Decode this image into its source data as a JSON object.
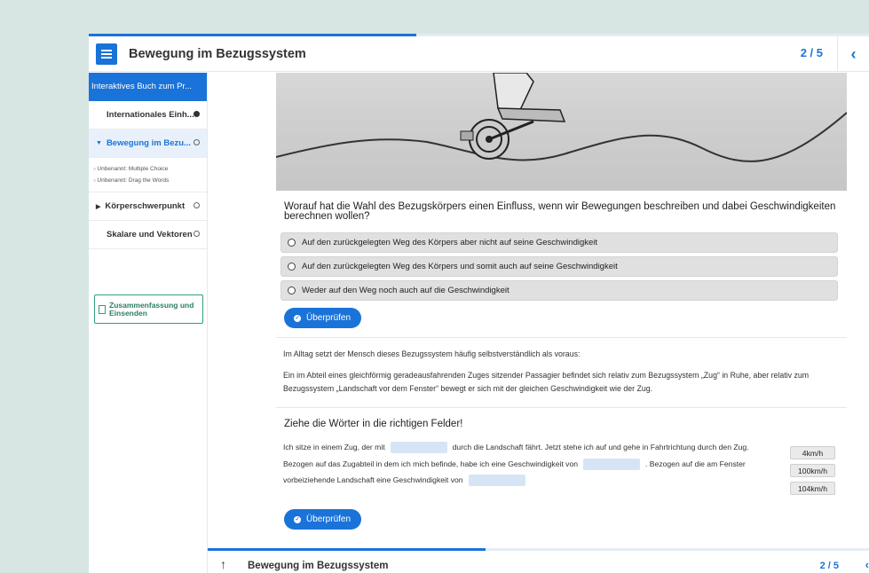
{
  "header": {
    "title": "Bewegung im Bezugssystem",
    "page_indicator": "2 / 5",
    "progress_percent": 42,
    "prev_icon": "chevron-left-icon",
    "menu_icon": "hamburger-menu-icon"
  },
  "sidebar": {
    "book_title": "Interaktives Buch zum Pr...",
    "items": [
      {
        "label": "Internationales Einh...",
        "status": "filled"
      },
      {
        "label": "Bewegung im Bezu...",
        "status": "hollow",
        "expanded": true
      },
      {
        "label": "Körperschwerpunkt",
        "status": "hollow"
      },
      {
        "label": "Skalare und Vektoren",
        "status": "hollow"
      }
    ],
    "sub_items": [
      "Unbenannt: Multiple Choice",
      "Unbenannt: Drag the Words"
    ],
    "summary_label": "Zusammenfassung und Einsenden"
  },
  "content": {
    "question": "Worauf hat die Wahl des Bezugskörpers einen Einfluss, wenn wir Bewegungen beschreiben und dabei Geschwindigkeiten berechnen wollen?",
    "alternatives": [
      "Auf den zurückgelegten Weg des Körpers aber nicht auf seine Geschwindigkeit",
      "Auf den zurückgelegten Weg des Körpers und somit auch auf seine Geschwindigkeit",
      "Weder auf den Weg noch auch auf die Geschwindigkeit"
    ],
    "check_label": "Überprüfen",
    "paragraph1": "Im Alltag setzt der Mensch dieses Bezugssystem häufig selbstverständlich als voraus:",
    "paragraph2": "Ein im Abteil eines gleichförmig geradeausfahrenden Zuges sitzender Passagier befindet sich relativ zum Bezugssystem „Zug“ in Ruhe, aber relativ zum Bezugssystem „Landschaft vor dem Fenster“ bewegt er sich mit der gleichen Geschwindigkeit wie der Zug.",
    "dnd_title": "Ziehe die Wörter in die richtigen Felder!",
    "dnd_parts": [
      "Ich sitze in einem Zug, der mit",
      "durch die Landschaft fährt. Jetzt stehe ich auf und gehe in Fahrtrichtung durch den Zug. Bezogen auf das Zugabteil in dem ich mich befinde, habe ich eine Geschwindigkeit von",
      ". Bezogen auf die am Fenster vorbeiziehende Landschaft eine Geschwindigkeit von"
    ],
    "words": [
      "4km/h",
      "100km/h",
      "104km/h"
    ],
    "check_label_2": "Überprüfen"
  },
  "footer": {
    "title": "Bewegung im Bezugssystem",
    "page_indicator": "2 / 5",
    "progress_percent": 42,
    "up_icon": "arrow-up-icon",
    "prev_icon": "chevron-left-icon"
  },
  "colors": {
    "accent": "#1a73d9",
    "summary": "#2fa07a",
    "page_bg": "#d7e6e2"
  }
}
